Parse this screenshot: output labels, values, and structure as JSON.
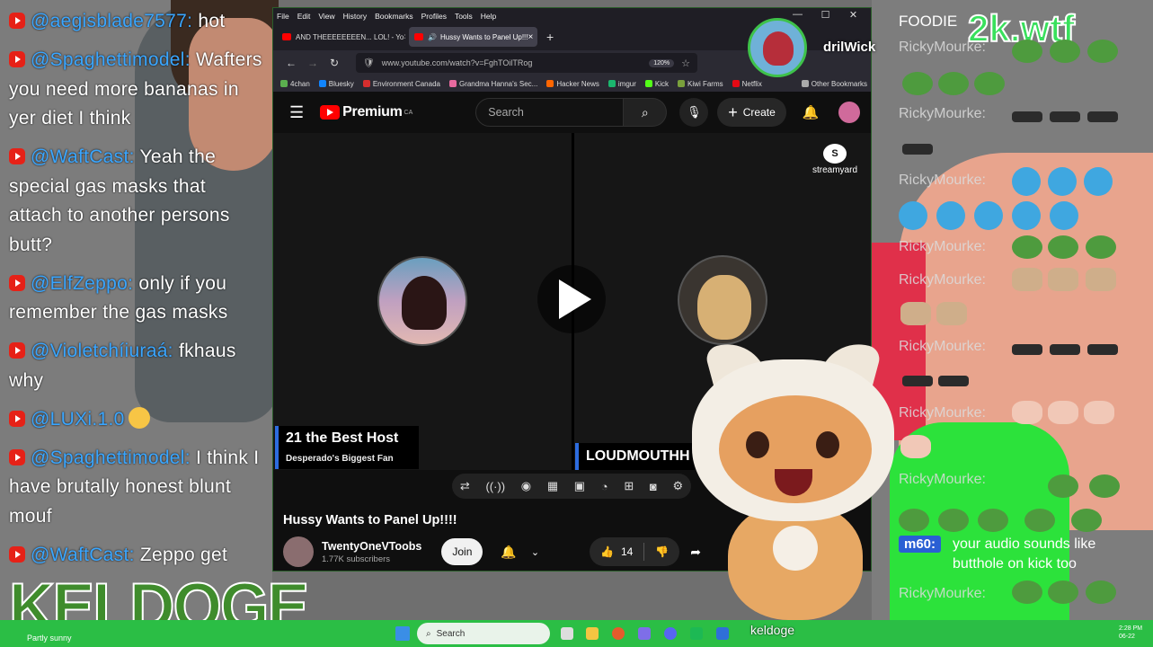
{
  "left_chat": {
    "messages": [
      {
        "user": "@aegisblade7577:",
        "text": "hot"
      },
      {
        "user": "@Spaghettimodel:",
        "text": "Wafters you need more bananas in yer diet I think"
      },
      {
        "user": "@WaftCast:",
        "text": "Yeah the special gas masks that attach to another persons butt?"
      },
      {
        "user": "@ElfZeppo:",
        "text": "only if you remember the gas masks"
      },
      {
        "user": "@Violetchíiuraá:",
        "text": "fkhaus why"
      },
      {
        "user": "@LUXi.1.0",
        "text": ""
      },
      {
        "user": "@Spaghettimodel:",
        "text": "I think I have brutally honest blunt mouf"
      },
      {
        "user": "@WaftCast:",
        "text": "Zeppo get"
      }
    ],
    "logo": "KELDOGE"
  },
  "right_chat": {
    "top_text": "FOODIE",
    "badge": "2k.wtf",
    "user": "RickyMourke:",
    "m60_user": "m60:",
    "m60_text": "your audio sounds like butthole on kick too"
  },
  "browser": {
    "menu": [
      "File",
      "Edit",
      "View",
      "History",
      "Bookmarks",
      "Profiles",
      "Tools",
      "Help"
    ],
    "window_controls": [
      "—",
      "☐",
      "✕"
    ],
    "tabs": [
      {
        "title": "AND THEEEEEEEEN... LOL! - Yo",
        "active": false
      },
      {
        "title": "Hussy Wants to Panel Up!!!",
        "active": true
      }
    ],
    "url": "www.youtube.com/watch?v=FghTOilTRog",
    "zoom": "120%",
    "bookmarks": [
      {
        "label": "4chan",
        "color": "#5bb04f"
      },
      {
        "label": "Bluesky",
        "color": "#1185fe"
      },
      {
        "label": "Environment Canada",
        "color": "#d62e2e"
      },
      {
        "label": "Grandma Hanna's Sec...",
        "color": "#e86a9f"
      },
      {
        "label": "Hacker News",
        "color": "#ff6600"
      },
      {
        "label": "imgur",
        "color": "#1bb76e"
      },
      {
        "label": "Kick",
        "color": "#53fc18"
      },
      {
        "label": "Kiwi Farms",
        "color": "#7aa03c"
      },
      {
        "label": "Netflix",
        "color": "#e50914"
      }
    ],
    "other_bookmarks": "Other Bookmarks"
  },
  "streamer": {
    "name": "drilWick"
  },
  "youtube": {
    "logo_text": "Premium",
    "region": "CA",
    "search_placeholder": "Search",
    "create_label": "Create",
    "streamyard_label": "streamyard",
    "guest1_name": "21 the Best Host",
    "guest1_sub": "Desperado's Biggest Fan",
    "guest2_name": "LOUDMOUTHH",
    "video_title": "Hussy Wants to Panel Up!!!!",
    "channel_name": "TwentyOneVToobs",
    "subscribers": "1.77K subscribers",
    "join_label": "Join",
    "likes": "14"
  },
  "taskbar": {
    "weather": "Partly sunny",
    "search_label": "Search",
    "watermark": "keldoge",
    "clock_time": "2:28 PM",
    "clock_date": "06-22"
  }
}
